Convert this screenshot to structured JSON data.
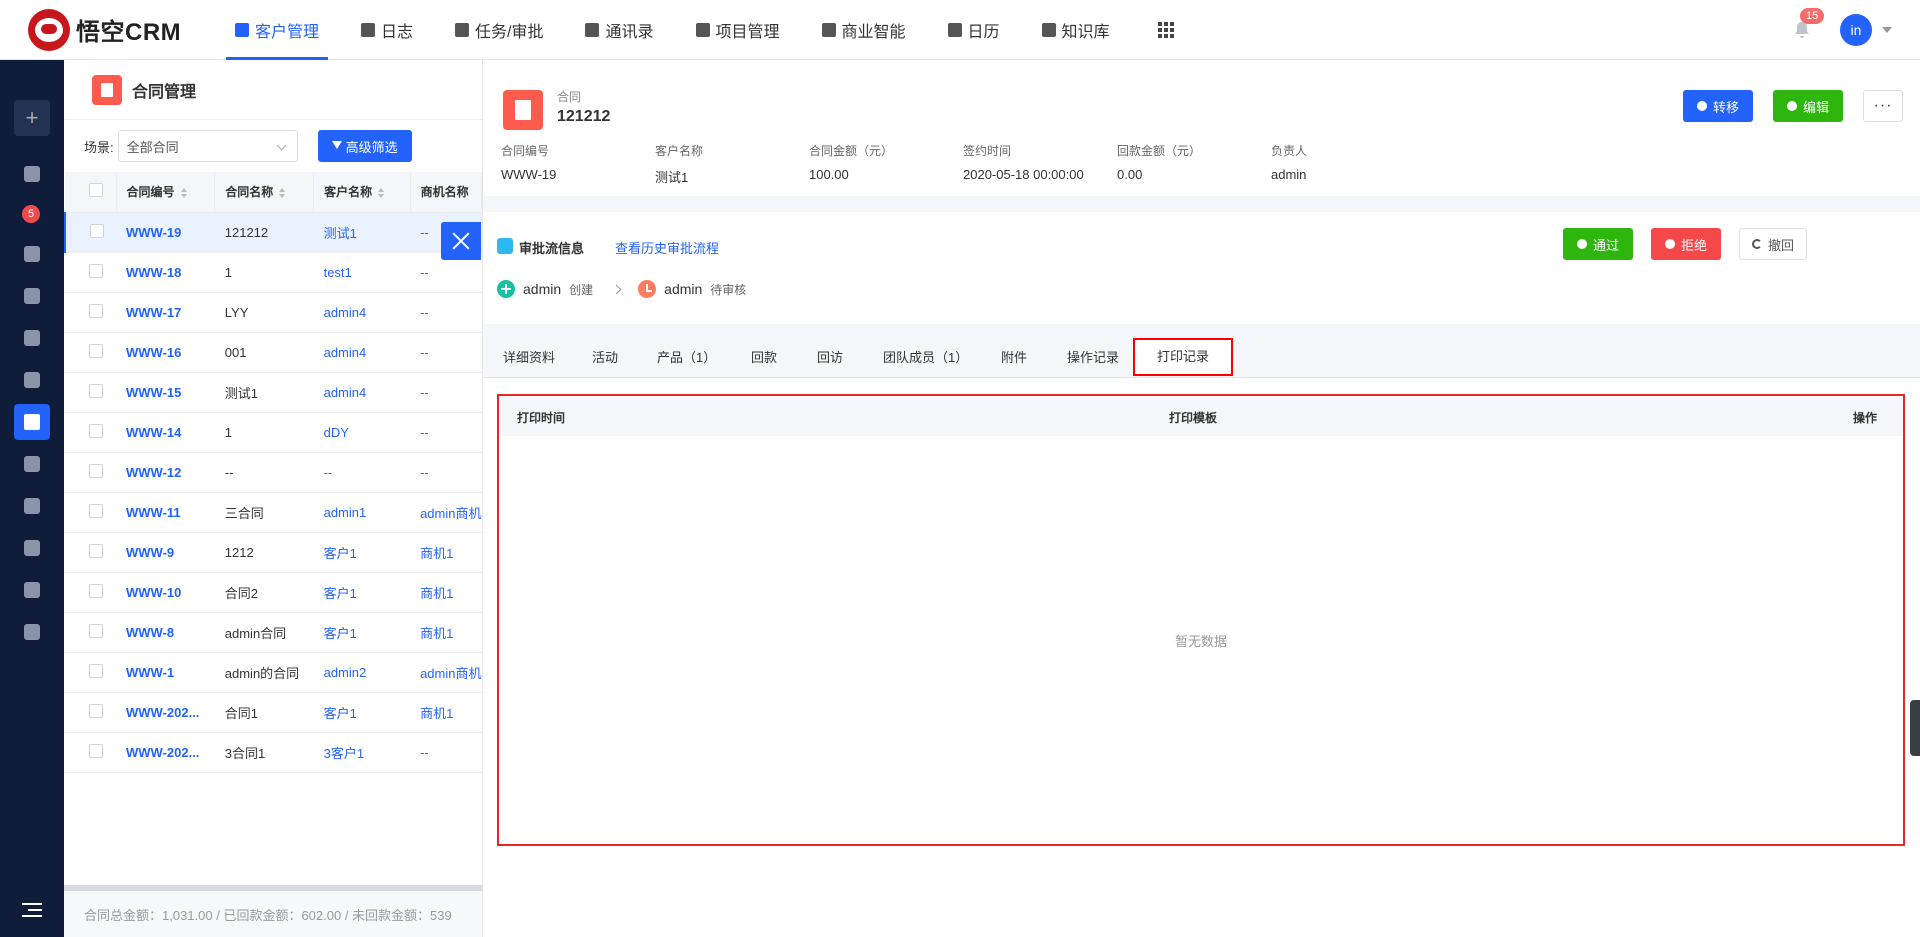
{
  "app": {
    "logo_text": "悟空CRM"
  },
  "nav": {
    "items": [
      {
        "label": "客户管理",
        "active": true
      },
      {
        "label": "日志"
      },
      {
        "label": "任务/审批"
      },
      {
        "label": "通讯录"
      },
      {
        "label": "项目管理"
      },
      {
        "label": "商业智能"
      },
      {
        "label": "日历"
      },
      {
        "label": "知识库"
      }
    ],
    "notification_count": "15",
    "user_initials": "in"
  },
  "sidebar": {
    "add_label": "+",
    "badge": "5"
  },
  "list": {
    "title": "合同管理",
    "scene_label": "场景:",
    "scene_value": "全部合同",
    "filter_button": "高级筛选",
    "columns": [
      "合同编号",
      "合同名称",
      "客户名称",
      "商机名称"
    ],
    "rows": [
      {
        "code": "WWW-19",
        "name": "121212",
        "customer": "测试1",
        "opportunity": "--"
      },
      {
        "code": "WWW-18",
        "name": "1",
        "customer": "test1",
        "opportunity": "--"
      },
      {
        "code": "WWW-17",
        "name": "LYY",
        "customer": "admin4",
        "opportunity": "--"
      },
      {
        "code": "WWW-16",
        "name": "001",
        "customer": "admin4",
        "opportunity": "--"
      },
      {
        "code": "WWW-15",
        "name": "测试1",
        "customer": "admin4",
        "opportunity": "--"
      },
      {
        "code": "WWW-14",
        "name": "1",
        "customer": "dDY",
        "opportunity": "--"
      },
      {
        "code": "WWW-12",
        "name": "--",
        "customer": "--",
        "opportunity": "--"
      },
      {
        "code": "WWW-11",
        "name": "三合同",
        "customer": "admin1",
        "opportunity": "admin商机"
      },
      {
        "code": "WWW-9",
        "name": "1212",
        "customer": "客户1",
        "opportunity": "商机1"
      },
      {
        "code": "WWW-10",
        "name": "合同2",
        "customer": "客户1",
        "opportunity": "商机1"
      },
      {
        "code": "WWW-8",
        "name": "admin合同",
        "customer": "客户1",
        "opportunity": "商机1"
      },
      {
        "code": "WWW-1",
        "name": "admin的合同",
        "customer": "admin2",
        "opportunity": "admin商机"
      },
      {
        "code": "WWW-202...",
        "name": "合同1",
        "customer": "客户1",
        "opportunity": "商机1"
      },
      {
        "code": "WWW-202...",
        "name": "3合同1",
        "customer": "3客户1",
        "opportunity": "--"
      }
    ],
    "footer": "合同总金额：1,031.00 / 已回款金额：602.00 / 未回款金额：539"
  },
  "detail": {
    "type_label": "合同",
    "name": "121212",
    "btn_transfer": "转移",
    "btn_edit": "编辑",
    "btn_more": "···",
    "fields": [
      {
        "key": "合同编号",
        "value": "WWW-19"
      },
      {
        "key": "客户名称",
        "value": "测试1"
      },
      {
        "key": "合同金额（元）",
        "value": "100.00"
      },
      {
        "key": "签约时间",
        "value": "2020-05-18 00:00:00"
      },
      {
        "key": "回款金额（元）",
        "value": "0.00"
      },
      {
        "key": "负责人",
        "value": "admin"
      }
    ],
    "approval": {
      "title": "审批流信息",
      "history_link": "查看历史审批流程",
      "btn_pass": "通过",
      "btn_reject": "拒绝",
      "btn_revoke": "撤回",
      "steps": [
        {
          "user": "admin",
          "status": "创建"
        },
        {
          "user": "admin",
          "status": "待审核"
        }
      ]
    },
    "tabs": [
      "详细资料",
      "活动",
      "产品（1）",
      "回款",
      "回访",
      "团队成员（1）",
      "附件",
      "操作记录",
      "打印记录"
    ],
    "print_table": {
      "columns": [
        "打印时间",
        "打印模板",
        "操作"
      ],
      "empty_text": "暂无数据"
    }
  },
  "colors": {
    "primary": "#2362fb",
    "success": "#2eb60f",
    "danger": "#f5484a",
    "highlight": "#e8262a",
    "sidebar_bg": "#0f1c3a"
  }
}
